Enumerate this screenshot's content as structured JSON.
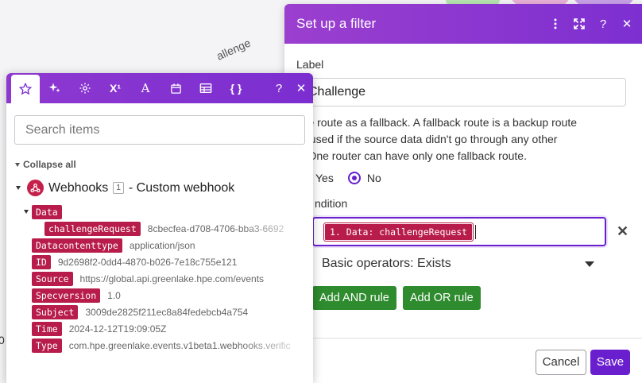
{
  "background": {
    "edge_label": "allenge",
    "left_edge_text": "0"
  },
  "filter": {
    "title": "Set up a filter",
    "label_field": {
      "label": "Label",
      "value": "Challenge"
    },
    "fallback_text_lines": [
      "t the route as a fallback. A fallback route is a backup route",
      "t is used if the source data didn't go through any other",
      "te. One router can have only one fallback route."
    ],
    "fallback_options": {
      "yes": "Yes",
      "no": "No",
      "selected": "No"
    },
    "condition_label": "ndition",
    "condition_value": "1. Data: challengeRequest",
    "operator": "Basic operators: Exists",
    "add_and_rule": "Add AND rule",
    "add_or_rule": "Add OR rule",
    "cancel": "Cancel",
    "save": "Save",
    "accent_color": "#6a1fcf"
  },
  "picker": {
    "search_placeholder": "Search items",
    "collapse_all": "Collapse all",
    "module": {
      "name": "Webhooks",
      "number": "1",
      "subtitle": "- Custom webhook"
    },
    "tree": {
      "data": {
        "label": "Data",
        "children": [
          {
            "key": "challengeRequest",
            "value": "8cbecfea-d708-4706-bba3-6692"
          }
        ]
      },
      "fields": [
        {
          "key": "Datacontenttype",
          "value": "application/json"
        },
        {
          "key": "ID",
          "value": "9d2698f2-0dd4-4870-b026-7e18c755e121"
        },
        {
          "key": "Source",
          "value": "https://global.api.greenlake.hpe.com/events"
        },
        {
          "key": "Specversion",
          "value": "1.0"
        },
        {
          "key": "Subject",
          "value": "3009de2825f211ec8a84fedebcb4a754"
        },
        {
          "key": "Time",
          "value": "2024-12-12T19:09:05Z"
        },
        {
          "key": "Type",
          "value": "com.hpe.greenlake.events.v1beta1.webhooks.verific"
        }
      ]
    },
    "tag_color": "#b71c4a",
    "tabs": [
      "star-icon",
      "sparkle-icon",
      "gear-icon",
      "superscript-icon",
      "text-icon",
      "calendar-icon",
      "table-icon",
      "braces-icon",
      "help-icon",
      "close-icon"
    ]
  }
}
